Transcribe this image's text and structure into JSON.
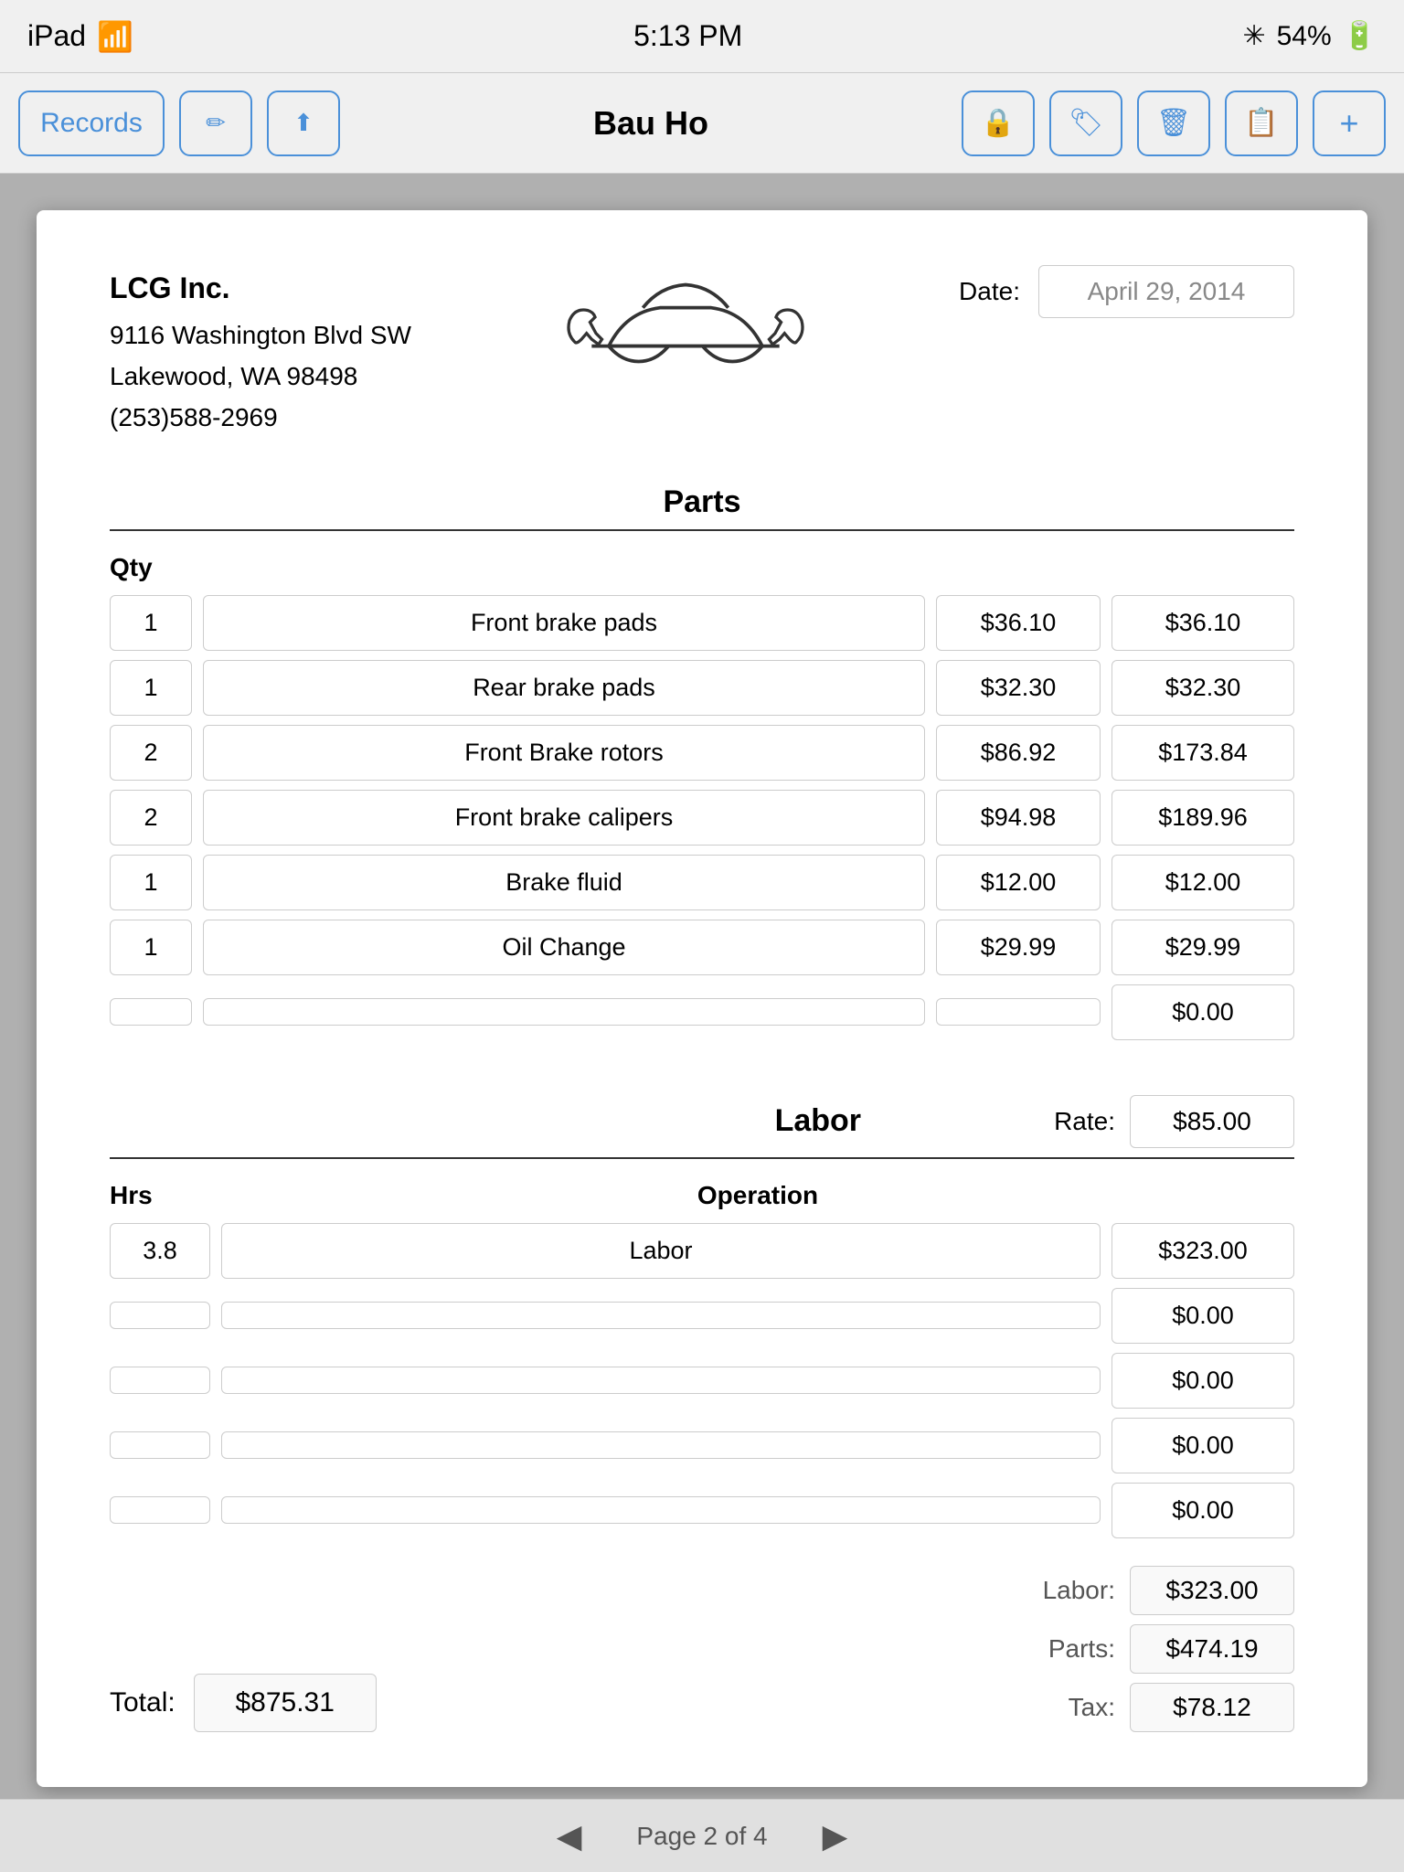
{
  "statusBar": {
    "device": "iPad",
    "wifi": "WiFi",
    "time": "5:13 PM",
    "bluetooth": "BT",
    "battery": "54%"
  },
  "toolbar": {
    "records_label": "Records",
    "title": "Bau Ho",
    "edit_icon": "✏️",
    "share_icon": "⬆",
    "lock_icon": "🔒",
    "tag_icon": "🏷",
    "trash_icon": "🗑",
    "copy_icon": "📋",
    "add_icon": "+"
  },
  "invoice": {
    "company": {
      "name": "LCG Inc.",
      "address1": "9116 Washington Blvd SW",
      "address2": "Lakewood, WA  98498",
      "phone": "(253)588-2969"
    },
    "date_label": "Date:",
    "date_value": "April 29, 2014",
    "parts_title": "Parts",
    "qty_header": "Qty",
    "parts": [
      {
        "qty": "1",
        "desc": "Front brake pads",
        "price": "$36.10",
        "total": "$36.10"
      },
      {
        "qty": "1",
        "desc": "Rear brake pads",
        "price": "$32.30",
        "total": "$32.30"
      },
      {
        "qty": "2",
        "desc": "Front Brake rotors",
        "price": "$86.92",
        "total": "$173.84"
      },
      {
        "qty": "2",
        "desc": "Front brake calipers",
        "price": "$94.98",
        "total": "$189.96"
      },
      {
        "qty": "1",
        "desc": "Brake fluid",
        "price": "$12.00",
        "total": "$12.00"
      },
      {
        "qty": "1",
        "desc": "Oil Change",
        "price": "$29.99",
        "total": "$29.99"
      },
      {
        "qty": "",
        "desc": "",
        "price": "",
        "total": "$0.00"
      }
    ],
    "labor_title": "Labor",
    "rate_label": "Rate:",
    "rate_value": "$85.00",
    "hrs_header": "Hrs",
    "operation_header": "Operation",
    "labor_rows": [
      {
        "hrs": "3.8",
        "op": "Labor",
        "total": "$323.00"
      },
      {
        "hrs": "",
        "op": "",
        "total": "$0.00"
      },
      {
        "hrs": "",
        "op": "",
        "total": "$0.00"
      },
      {
        "hrs": "",
        "op": "",
        "total": "$0.00"
      },
      {
        "hrs": "",
        "op": "",
        "total": "$0.00"
      }
    ],
    "total_label": "Total:",
    "total_value": "$875.31",
    "labor_label": "Labor:",
    "labor_value": "$323.00",
    "parts_label": "Parts:",
    "parts_value": "$474.19",
    "tax_label": "Tax:",
    "tax_value": "$78.12"
  },
  "pagination": {
    "text": "Page 2 of 4",
    "prev": "◀",
    "next": "▶"
  }
}
